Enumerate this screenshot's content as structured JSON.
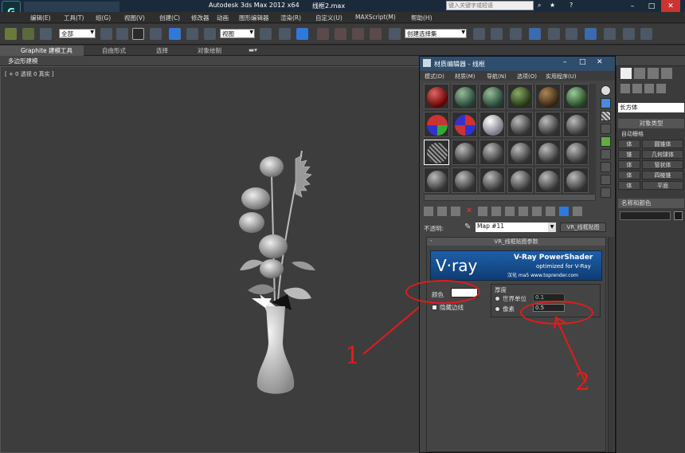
{
  "titlebar": {
    "title": "Autodesk 3ds Max  2012 x64",
    "file": "线框2.max",
    "search_placeholder": "键入关键字或短语"
  },
  "menubar": {
    "items": [
      "编辑(E)",
      "工具(T)",
      "组(G)",
      "视图(V)",
      "创建(C)",
      "修改器",
      "动画",
      "图形编辑器",
      "渲染(R)",
      "自定义(U)",
      "MAXScript(M)",
      "帮助(H)"
    ]
  },
  "toolbar": {
    "filter_value": "全部",
    "viewcoord_value": "视图",
    "selset_value": "创建选择集"
  },
  "ribbon": {
    "tabs": [
      "Graphite 建模工具",
      "自由形式",
      "选择",
      "对象绘制"
    ],
    "subtab": "多边形建模"
  },
  "viewport": {
    "label": "[ + 0 透视 0 真实 ]"
  },
  "cmdpanel": {
    "dropdown": "长方体",
    "section_type": "对象类型",
    "autogrid": "自动栅格",
    "buttons": [
      "体",
      "锥",
      "体",
      "体",
      "体"
    ],
    "buttons_right": [
      "圆锥体",
      "几何球体",
      "管状体",
      "四棱锥",
      "平面"
    ],
    "section_name": "名称和颜色"
  },
  "mated": {
    "title": "材质编辑器 - 线框",
    "menu": [
      "模式(D)",
      "材质(M)",
      "导航(N)",
      "选项(O)",
      "实用程序(U)"
    ],
    "opacity_label": "不透明:",
    "map_name": "Map #11",
    "map_type": "VR_线框贴图",
    "rollout_title": "VR_线框贴图参数",
    "banner_logo": "V·ray",
    "banner_title": "V-Ray PowerShader",
    "banner_sub": "optimized for V-Ray",
    "banner_credit": "汉化 ma5 www.toprender.com",
    "color_label": "颜色",
    "hide_edges_label": "隐藏边线",
    "thickness_label": "厚度",
    "world_units_label": "世界单位",
    "world_units_value": "0.1",
    "pixels_label": "像素",
    "pixels_value": "0.5"
  },
  "annotations": {
    "one": "1",
    "two": "2",
    "color": "#e41b1b"
  }
}
